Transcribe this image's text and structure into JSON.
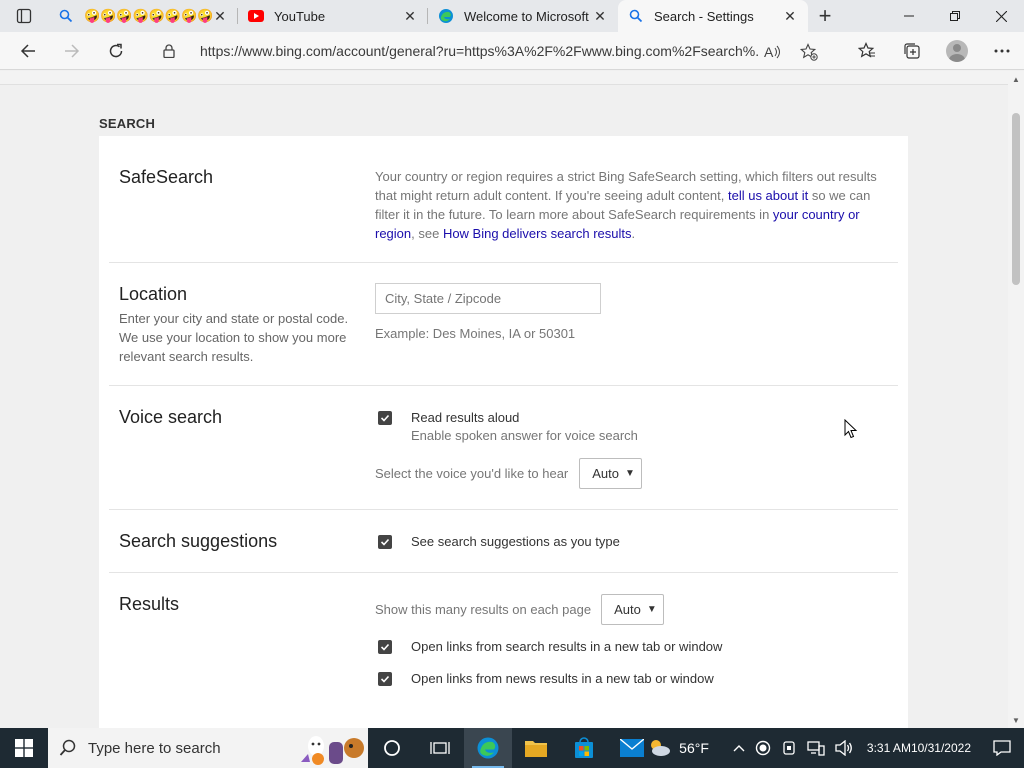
{
  "browser": {
    "tabs": [
      {
        "title": "🤪🤪🤪🤪🤪🤪🤪🤪🤪",
        "icon": "search-icon",
        "active": false
      },
      {
        "title": "YouTube",
        "icon": "youtube-icon",
        "active": false
      },
      {
        "title": "Welcome to Microsoft Edge",
        "icon": "edge-icon",
        "active": false
      },
      {
        "title": "Search - Settings",
        "icon": "search-icon",
        "active": true
      }
    ],
    "url": "https://www.bing.com/account/general?ru=https%3A%2F%2Fwww.bing.com%2Fsearch%..."
  },
  "page": {
    "section_heading": "SEARCH",
    "safesearch": {
      "title": "SafeSearch",
      "text1": "Your country or region requires a strict Bing SafeSearch setting, which filters out results that might return adult content. If you're seeing adult content, ",
      "link1": "tell us about it",
      "text2": " so we can filter it in the future. To learn more about SafeSearch requirements in ",
      "link2": "your country or region",
      "text3": ", see ",
      "link3": "How Bing delivers search results",
      "text4": "."
    },
    "location": {
      "title": "Location",
      "description": "Enter your city and state or postal code. We use your location to show you more relevant search results.",
      "placeholder": "City, State / Zipcode",
      "example": "Example: Des Moines, IA or 50301"
    },
    "voice": {
      "title": "Voice search",
      "checkbox_label": "Read results aloud",
      "checkbox_sub": "Enable spoken answer for voice search",
      "checked": true,
      "select_label": "Select the voice you'd like to hear",
      "select_value": "Auto"
    },
    "suggestions": {
      "title": "Search suggestions",
      "checkbox_label": "See search suggestions as you type",
      "checked": true
    },
    "results": {
      "title": "Results",
      "select_label": "Show this many results on each page",
      "select_value": "Auto",
      "checkbox1_label": "Open links from search results in a new tab or window",
      "checkbox2_label": "Open links from news results in a new tab or window"
    }
  },
  "taskbar": {
    "search_placeholder": "Type here to search",
    "weather": "56°F",
    "time": "3:31 AM",
    "date": "10/31/2022"
  }
}
